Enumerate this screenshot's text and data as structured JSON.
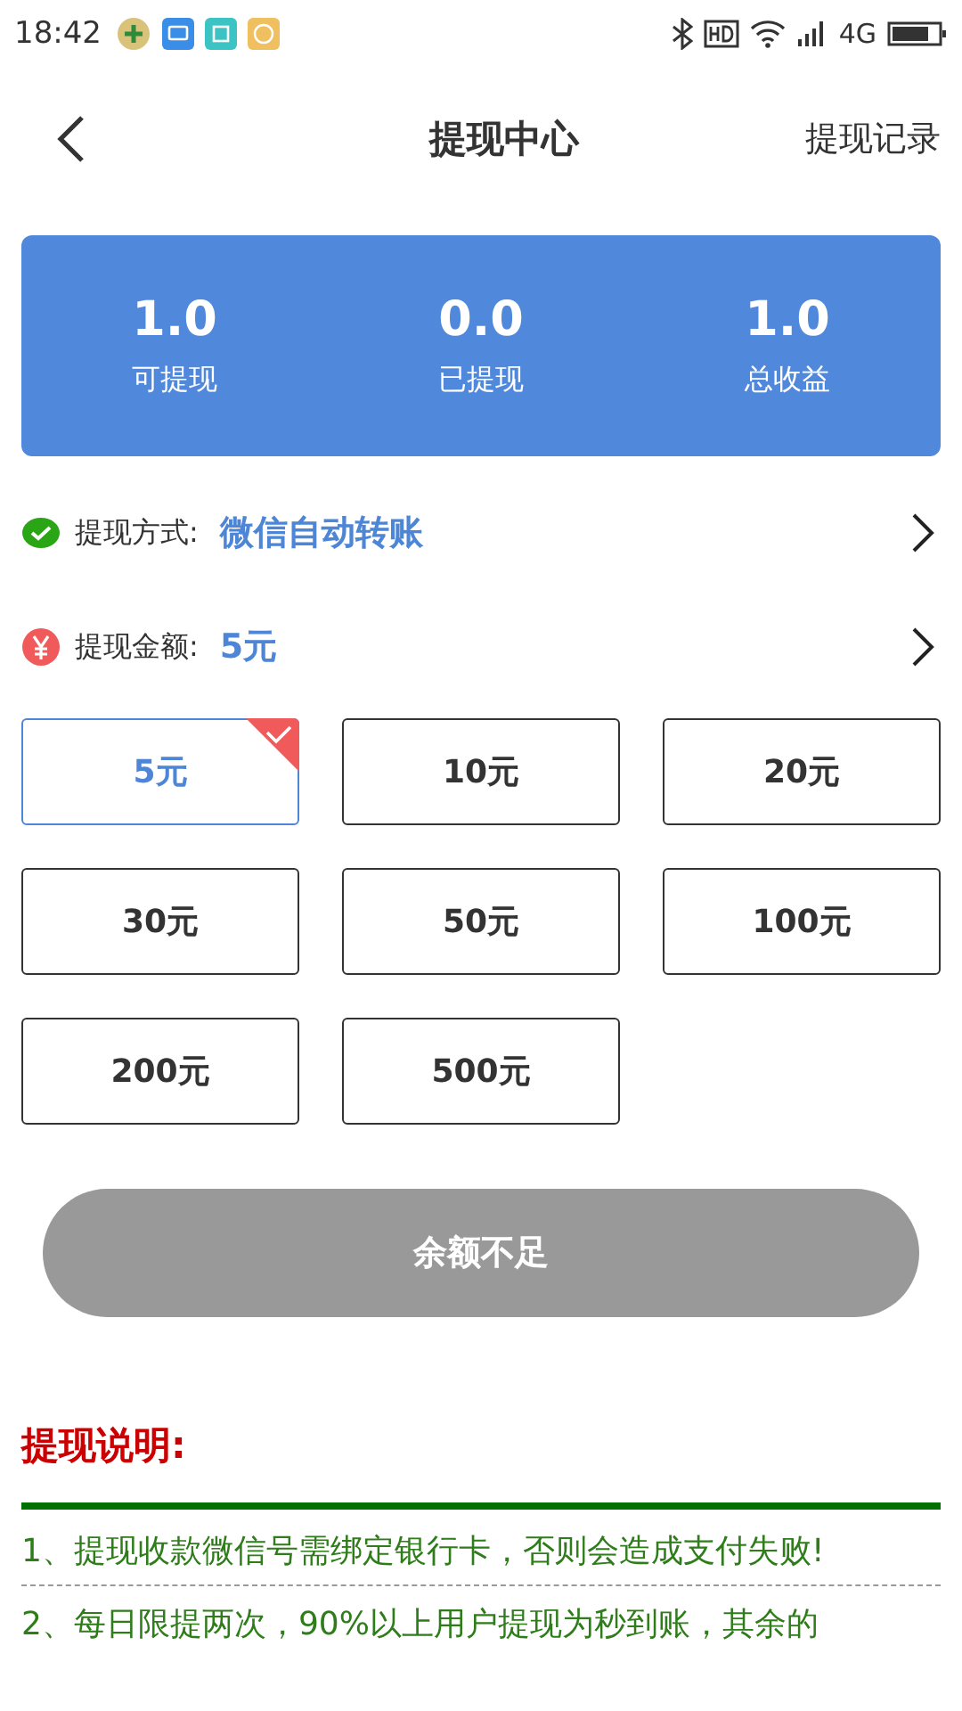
{
  "status_bar": {
    "time": "18:42",
    "network": "4G"
  },
  "header": {
    "title": "提现中心",
    "action": "提现记录"
  },
  "summary": [
    {
      "value": "1.0",
      "label": "可提现"
    },
    {
      "value": "0.0",
      "label": "已提现"
    },
    {
      "value": "1.0",
      "label": "总收益"
    }
  ],
  "method": {
    "label": "提现方式:",
    "value": "微信自动转账"
  },
  "amount": {
    "label": "提现金额:",
    "value": "5元"
  },
  "options": [
    {
      "label": "5元",
      "selected": true
    },
    {
      "label": "10元",
      "selected": false
    },
    {
      "label": "20元",
      "selected": false
    },
    {
      "label": "30元",
      "selected": false
    },
    {
      "label": "50元",
      "selected": false
    },
    {
      "label": "100元",
      "selected": false
    },
    {
      "label": "200元",
      "selected": false
    },
    {
      "label": "500元",
      "selected": false
    }
  ],
  "submit": {
    "label": "余额不足",
    "disabled": true
  },
  "notes": {
    "title": "提现说明:",
    "items": [
      "1、提现收款微信号需绑定银行卡，否则会造成支付失败!",
      "2、每日限提两次，90%以上用户提现为秒到账，其余的"
    ]
  }
}
